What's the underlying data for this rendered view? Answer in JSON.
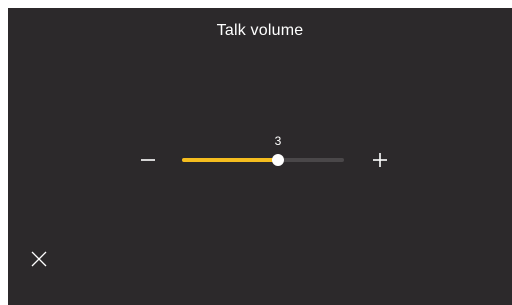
{
  "screen": {
    "title": "Talk volume"
  },
  "volume": {
    "value": "3",
    "level_fraction": 0.59
  },
  "icons": {
    "decrease": "minus-icon",
    "increase": "plus-icon",
    "close": "close-icon"
  },
  "colors": {
    "background": "#2c292b",
    "accent": "#f5bd1f",
    "track": "#4a4749",
    "foreground": "#ffffff"
  }
}
